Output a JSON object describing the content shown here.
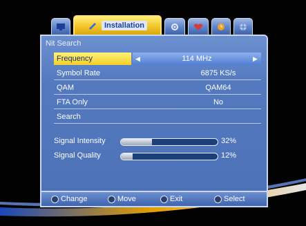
{
  "tabs": [
    {
      "icon": "tv-icon"
    },
    {
      "icon": "wrench-icon",
      "label": "Installation",
      "active": true
    },
    {
      "icon": "gear-icon"
    },
    {
      "icon": "heart-icon"
    },
    {
      "icon": "clock-icon"
    },
    {
      "icon": "globe-icon"
    }
  ],
  "title": "Nit Search",
  "menu": [
    {
      "label": "Frequency",
      "value": "114 MHz"
    },
    {
      "label": "Symbol Rate",
      "value": "6875 KS/s"
    },
    {
      "label": "QAM",
      "value": "QAM64"
    },
    {
      "label": "FTA Only",
      "value": "No"
    },
    {
      "label": "Search",
      "value": ""
    }
  ],
  "signal": {
    "intensity": {
      "label": "Signal Intensity",
      "value": "32%",
      "level": 0.32
    },
    "quality": {
      "label": "Signal Quality",
      "value": "12%",
      "level": 0.12
    }
  },
  "help": [
    {
      "icon": "left-right-icon",
      "label": "Change"
    },
    {
      "icon": "up-down-icon",
      "label": "Move"
    },
    {
      "icon": "exit-button-icon",
      "label": "Exit"
    },
    {
      "icon": "ok-button-icon",
      "label": "Select"
    }
  ],
  "colors": {
    "selected_label_bg": "#f5d02a",
    "panel_bg": "#5479bf",
    "active_tab": "#f2c529"
  }
}
